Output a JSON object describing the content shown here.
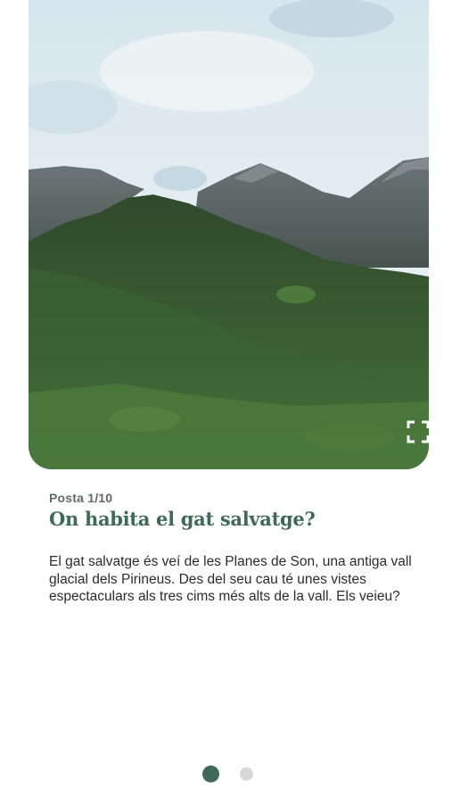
{
  "post": {
    "counter": "Posta 1/10",
    "title": "On habita el gat salvatge?",
    "body": "El gat salvatge és veí de les Planes de Son, una antiga vall glacial dels Pirineus. Des del seu cau té unes vistes espectaculars als tres cims més alts de la vall. Els veieu?"
  },
  "image": {
    "subject": "forested-mountain-landscape",
    "expand_icon": "fullscreen-expand-icon"
  },
  "pagination": {
    "total_dots": 2,
    "active_index": 0
  },
  "colors": {
    "accent": "#3f6b56",
    "kicker": "#5d6b63",
    "text": "#2b2b2b",
    "dot_inactive": "#d8d8d8"
  }
}
